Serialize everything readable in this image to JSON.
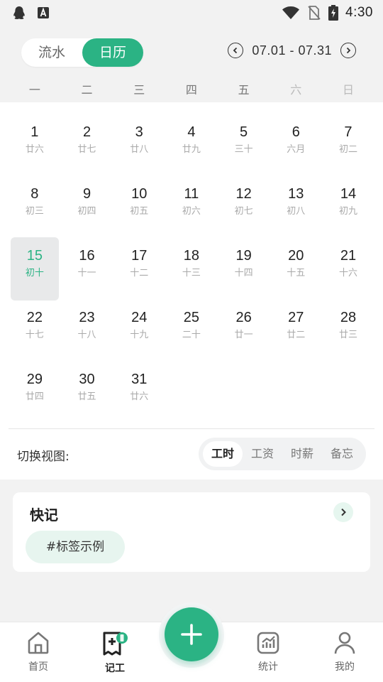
{
  "status": {
    "time": "4:30"
  },
  "header": {
    "tabs": [
      {
        "label": "流水"
      },
      {
        "label": "日历"
      }
    ],
    "active_tab": "日历",
    "range": "07.01 - 07.31"
  },
  "weekdays": [
    "一",
    "二",
    "三",
    "四",
    "五",
    "六",
    "日"
  ],
  "calendar": {
    "selected_day": "15",
    "days": [
      {
        "num": "1",
        "lunar": "廿六"
      },
      {
        "num": "2",
        "lunar": "廿七"
      },
      {
        "num": "3",
        "lunar": "廿八"
      },
      {
        "num": "4",
        "lunar": "廿九"
      },
      {
        "num": "5",
        "lunar": "三十"
      },
      {
        "num": "6",
        "lunar": "六月"
      },
      {
        "num": "7",
        "lunar": "初二"
      },
      {
        "num": "8",
        "lunar": "初三"
      },
      {
        "num": "9",
        "lunar": "初四"
      },
      {
        "num": "10",
        "lunar": "初五"
      },
      {
        "num": "11",
        "lunar": "初六"
      },
      {
        "num": "12",
        "lunar": "初七"
      },
      {
        "num": "13",
        "lunar": "初八"
      },
      {
        "num": "14",
        "lunar": "初九"
      },
      {
        "num": "15",
        "lunar": "初十"
      },
      {
        "num": "16",
        "lunar": "十一"
      },
      {
        "num": "17",
        "lunar": "十二"
      },
      {
        "num": "18",
        "lunar": "十三"
      },
      {
        "num": "19",
        "lunar": "十四"
      },
      {
        "num": "20",
        "lunar": "十五"
      },
      {
        "num": "21",
        "lunar": "十六"
      },
      {
        "num": "22",
        "lunar": "十七"
      },
      {
        "num": "23",
        "lunar": "十八"
      },
      {
        "num": "24",
        "lunar": "十九"
      },
      {
        "num": "25",
        "lunar": "二十"
      },
      {
        "num": "26",
        "lunar": "廿一"
      },
      {
        "num": "27",
        "lunar": "廿二"
      },
      {
        "num": "28",
        "lunar": "廿三"
      },
      {
        "num": "29",
        "lunar": "廿四"
      },
      {
        "num": "30",
        "lunar": "廿五"
      },
      {
        "num": "31",
        "lunar": "廿六"
      }
    ]
  },
  "view_switch": {
    "label": "切换视图:",
    "options": [
      "工时",
      "工资",
      "时薪",
      "备忘"
    ],
    "active": "工时"
  },
  "quick_note": {
    "title": "快记",
    "tag": "#标签示例"
  },
  "nav": {
    "items": [
      {
        "label": "首页",
        "icon": "home-icon"
      },
      {
        "label": "记工",
        "icon": "record-icon"
      },
      {
        "label": "统计",
        "icon": "stats-icon"
      },
      {
        "label": "我的",
        "icon": "profile-icon"
      }
    ],
    "active": "记工"
  },
  "colors": {
    "accent": "#2bb384",
    "accent_light": "#e7f5ef",
    "bg": "#f2f2f2"
  }
}
